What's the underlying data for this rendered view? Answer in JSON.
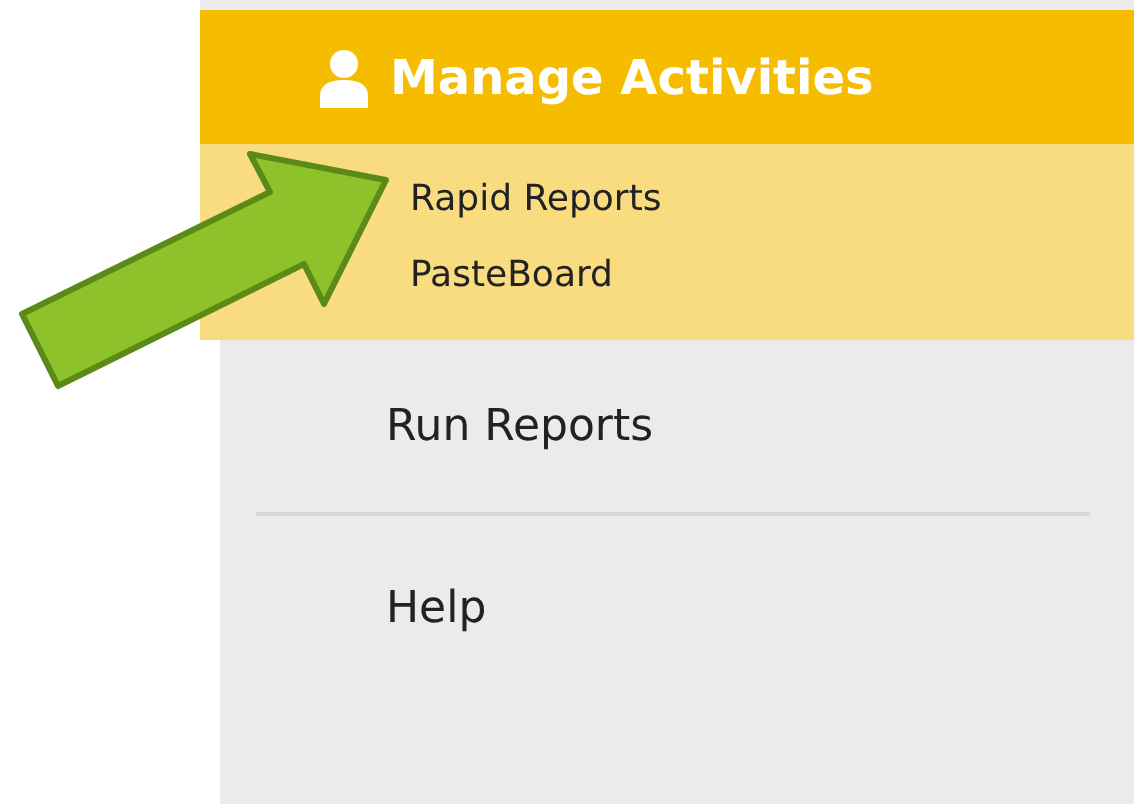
{
  "menu": {
    "header": {
      "title": "Manage Activities",
      "expanded": true
    },
    "header_items": [
      {
        "label": "Rapid Reports"
      },
      {
        "label": "PasteBoard"
      }
    ],
    "items": [
      {
        "label": "Run Reports"
      },
      {
        "label": "Help"
      }
    ]
  }
}
